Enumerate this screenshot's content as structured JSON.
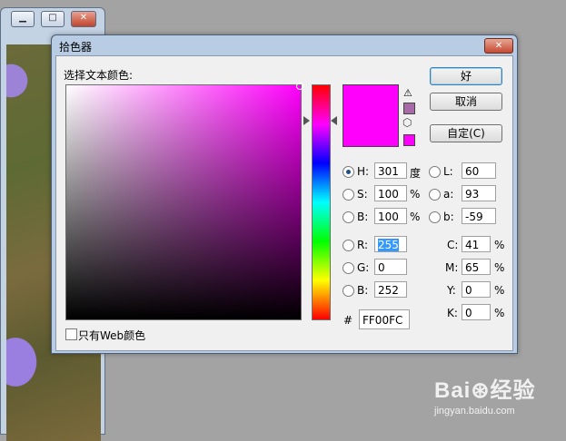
{
  "background_window": {
    "minimize_glyph": "▁",
    "maximize_glyph": "□",
    "close_glyph": "✕"
  },
  "dialog": {
    "title": "拾色器",
    "close_glyph": "✕",
    "prompt": "选择文本颜色:",
    "buttons": {
      "ok": "好",
      "cancel": "取消",
      "custom": "自定(C)"
    },
    "selected_color": "#ff00fc",
    "gamut_warning_color": "#a86aa7",
    "web_safe_color": "#ff00ff",
    "web_only_label": "只有Web颜色",
    "hsb": {
      "h_label": "H:",
      "h_value": "301",
      "h_unit": "度",
      "s_label": "S:",
      "s_value": "100",
      "s_unit": "%",
      "b_label": "B:",
      "b_value": "100",
      "b_unit": "%"
    },
    "lab": {
      "l_label": "L:",
      "l_value": "60",
      "a_label": "a:",
      "a_value": "93",
      "b_label": "b:",
      "b_value": "-59"
    },
    "rgb": {
      "r_label": "R:",
      "r_value": "255",
      "g_label": "G:",
      "g_value": "0",
      "b_label": "B:",
      "b_value": "252"
    },
    "cmyk": {
      "c_label": "C:",
      "c_value": "41",
      "m_label": "M:",
      "m_value": "65",
      "y_label": "Y:",
      "y_value": "0",
      "k_label": "K:",
      "k_value": "0",
      "unit": "%"
    },
    "hex_label": "#",
    "hex_value": "FF00FC"
  },
  "watermark": {
    "main": "Bai⊛经验",
    "sub": "jingyan.baidu.com"
  }
}
